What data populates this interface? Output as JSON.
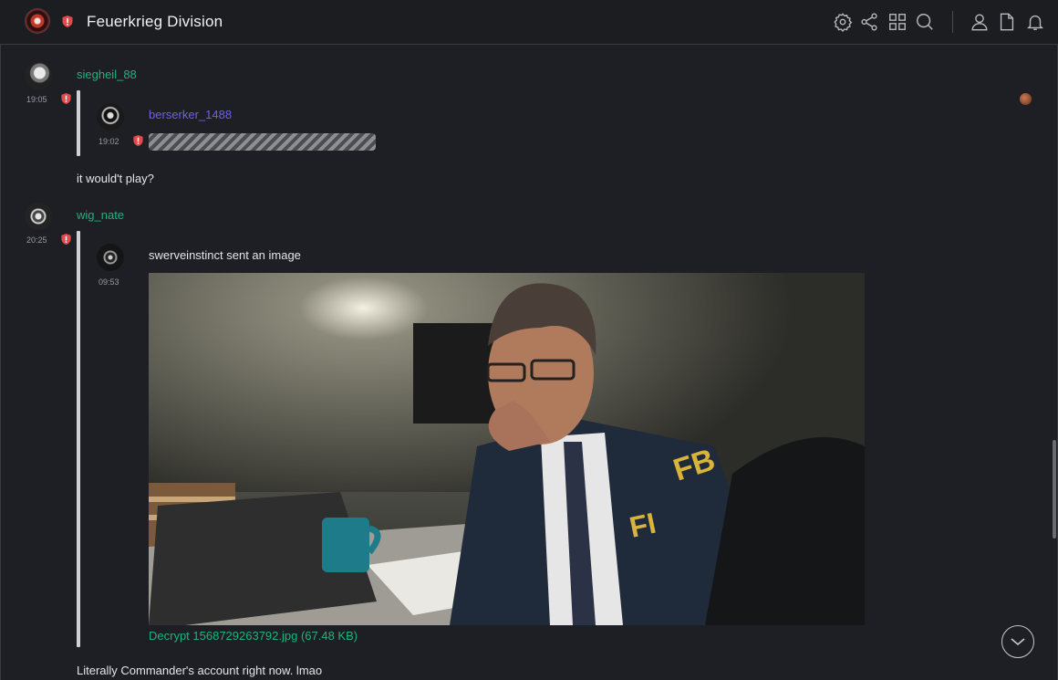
{
  "header": {
    "room_name": "Feuerkrieg Division",
    "icons": [
      "settings-icon",
      "share-icon",
      "grid-icon",
      "search-icon",
      "person-icon",
      "file-icon",
      "bell-icon"
    ]
  },
  "messages": [
    {
      "username": "siegheil_88",
      "username_color": "#1fb37d",
      "time": "19:05",
      "quote": {
        "username": "berserker_1488",
        "username_color": "#6d5ff0",
        "time": "19:02",
        "spoiler": true
      },
      "body": "it would't play?"
    },
    {
      "username": "wig_nate",
      "username_color": "#1fb37d",
      "time": "20:25",
      "quote": {
        "time": "09:53",
        "text": "swerveinstinct sent an image",
        "file_link": "Decrypt 1568729263792.jpg (67.48 KB)",
        "image_icon": "photo-man-at-desk-fbi-jacket"
      },
      "body": "Literally Commander's account right now. lmao"
    }
  ],
  "colors": {
    "accent_green": "#1fb37d",
    "accent_purple": "#6d5ff0",
    "shield_red": "#e04b4b",
    "background": "#1e1f24"
  }
}
